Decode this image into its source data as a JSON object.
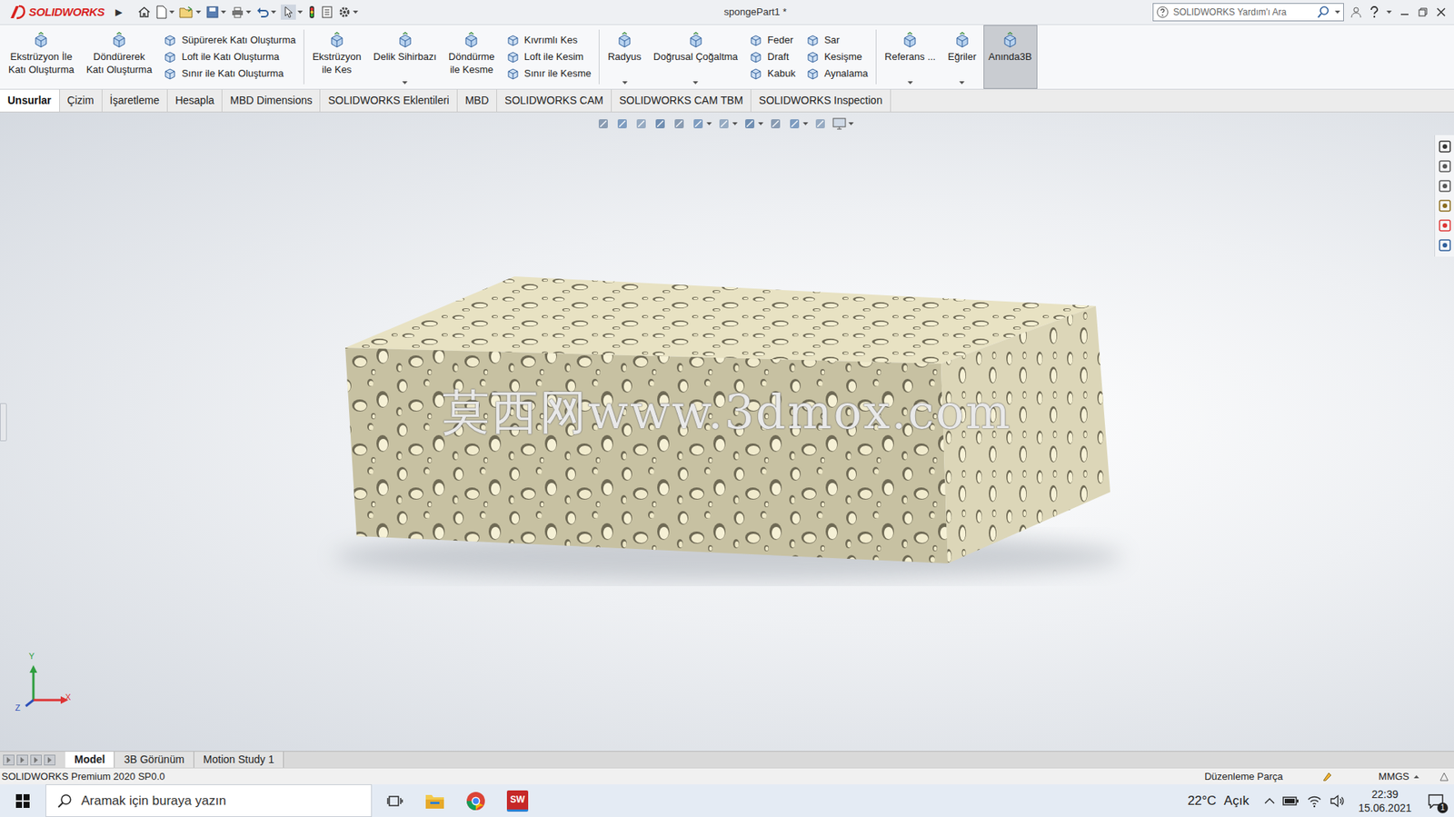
{
  "window": {
    "title": "spongePart1 *"
  },
  "logo": {
    "text": "SOLIDWORKS",
    "arrow": "▶"
  },
  "help_search": {
    "placeholder": "SOLIDWORKS Yardım'ı Ara"
  },
  "ribbon": {
    "groups": [
      [
        {
          "kind": "large",
          "lines": [
            "Ekstrüzyon İle",
            "Katı Oluşturma"
          ],
          "on": false,
          "dropdown": false
        },
        {
          "kind": "large",
          "lines": [
            "Döndürerek",
            "Katı Oluşturma"
          ],
          "on": false,
          "dropdown": false
        },
        {
          "kind": "stack",
          "items": [
            "Süpürerek Katı Oluşturma",
            "Loft ile Katı Oluşturma",
            "Sınır ile Katı Oluşturma"
          ]
        }
      ],
      [
        {
          "kind": "large",
          "lines": [
            "Ekstrüzyon",
            "ile Kes"
          ],
          "on": false,
          "dropdown": false
        },
        {
          "kind": "large",
          "lines": [
            "Delik Sihirbazı"
          ],
          "on": false,
          "dropdown": true
        },
        {
          "kind": "large",
          "lines": [
            "Döndürme",
            "ile Kesme"
          ],
          "on": false,
          "dropdown": false
        },
        {
          "kind": "stack",
          "items": [
            "Kıvrımlı Kes",
            "Loft ile Kesim",
            "Sınır ile Kesme"
          ]
        }
      ],
      [
        {
          "kind": "large",
          "lines": [
            "Radyus"
          ],
          "on": false,
          "dropdown": true
        },
        {
          "kind": "large",
          "lines": [
            "Doğrusal Çoğaltma"
          ],
          "on": false,
          "dropdown": true
        },
        {
          "kind": "stack",
          "items": [
            "Feder",
            "Draft",
            "Kabuk"
          ]
        },
        {
          "kind": "stack",
          "items": [
            "Sar",
            "Kesişme",
            "Aynalama"
          ]
        }
      ],
      [
        {
          "kind": "large",
          "lines": [
            "Referans ..."
          ],
          "on": false,
          "dropdown": true
        },
        {
          "kind": "large",
          "lines": [
            "Eğriler"
          ],
          "on": false,
          "dropdown": true
        },
        {
          "kind": "large",
          "lines": [
            "Anında3B"
          ],
          "on": true,
          "dropdown": false
        }
      ]
    ]
  },
  "tabs": [
    {
      "label": "Unsurlar",
      "selected": true
    },
    {
      "label": "Çizim",
      "selected": false
    },
    {
      "label": "İşaretleme",
      "selected": false
    },
    {
      "label": "Hesapla",
      "selected": false
    },
    {
      "label": "MBD Dimensions",
      "selected": false
    },
    {
      "label": "SOLIDWORKS Eklentileri",
      "selected": false
    },
    {
      "label": "MBD",
      "selected": false
    },
    {
      "label": "SOLIDWORKS CAM",
      "selected": false
    },
    {
      "label": "SOLIDWORKS CAM TBM",
      "selected": false
    },
    {
      "label": "SOLIDWORKS Inspection",
      "selected": false
    }
  ],
  "watermark": "莫西网www.3dmox.com",
  "triad": {
    "y": "Y",
    "x": "X",
    "z": "Z"
  },
  "bottom_tabs": [
    {
      "label": "Model",
      "selected": true
    },
    {
      "label": "3B Görünüm",
      "selected": false
    },
    {
      "label": "Motion Study 1",
      "selected": false
    }
  ],
  "status_bar": {
    "version": "SOLIDWORKS Premium 2020 SP0.0",
    "mode": "Düzenleme Parça",
    "units": "MMGS"
  },
  "taskbar": {
    "search_placeholder": "Aramak için buraya yazın",
    "sw_label": "SW",
    "weather": "22°C",
    "condition": "Açık",
    "time": "22:39",
    "date": "15.06.2021",
    "notifications": "1"
  }
}
